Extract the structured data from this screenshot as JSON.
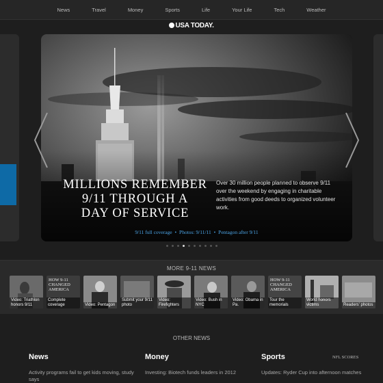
{
  "nav": {
    "items": [
      "News",
      "Travel",
      "Money",
      "Sports",
      "Life",
      "Your Life",
      "Tech",
      "Weather"
    ]
  },
  "logo": {
    "text": "USA TODAY."
  },
  "hero": {
    "headline_lines": [
      "MILLIONS REMEMBER",
      "9/11 THROUGH A",
      "DAY OF SERVICE"
    ],
    "summary": "Over 30 million people planned to observe 9/11 over the weekend by engaging in charitable activities from good deeds to organized volunteer work.",
    "links": [
      "9/11 full coverage",
      "Photos: 9/11/11",
      "Pentagon after 9/11"
    ],
    "link_separator": "•",
    "slide_count": 10,
    "active_slide": 3
  },
  "more_news": {
    "title": "MORE 9-11 NEWS",
    "thumbs": [
      {
        "caption": "Video: Triathlon honors 9/11",
        "overlay": ""
      },
      {
        "caption": "Complete coverage",
        "overlay": "HOW 9-11 CHANGED AMERICA"
      },
      {
        "caption": "Video: Pentagon",
        "overlay": ""
      },
      {
        "caption": "Submit your 9/11 photo",
        "overlay": ""
      },
      {
        "caption": "Video: Firefighters",
        "overlay": ""
      },
      {
        "caption": "Video: Bush in NYC",
        "overlay": ""
      },
      {
        "caption": "Video: Obama in Pa.",
        "overlay": ""
      },
      {
        "caption": "Tour the memorials",
        "overlay": "HOW 9-11 CHANGED AMERICA"
      },
      {
        "caption": "World honors victims",
        "overlay": ""
      },
      {
        "caption": "Readers' photos",
        "overlay": ""
      }
    ]
  },
  "other_news": {
    "title": "OTHER NEWS",
    "news": {
      "heading": "News",
      "item": "Activity programs fail to get kids moving, study says"
    },
    "money": {
      "heading": "Money",
      "item": "Investing: Biotech funds leaders in 2012"
    },
    "sports": {
      "heading": "Sports",
      "item": "Updates: Ryder Cup into afternoon matches",
      "link": "NFL SCORES"
    }
  },
  "colors": {
    "background": "#1e1e1e",
    "link_blue": "#4da6e8",
    "left_accent": "#0e6aa6"
  }
}
